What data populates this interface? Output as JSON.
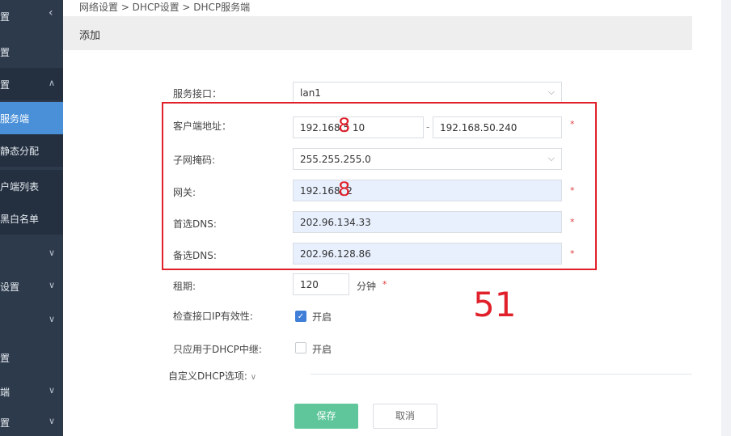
{
  "sidebar": {
    "items": [
      {
        "label": "置",
        "chevron": ""
      },
      {
        "label": "置",
        "chevron": "∧"
      },
      {
        "label": "服务端",
        "chevron": ""
      },
      {
        "label": "静态分配",
        "chevron": ""
      },
      {
        "label": "户端列表",
        "chevron": ""
      },
      {
        "label": "黑白名单",
        "chevron": ""
      },
      {
        "label": "",
        "chevron": "∨"
      },
      {
        "label": "设置",
        "chevron": "∨"
      },
      {
        "label": "",
        "chevron": "∨"
      },
      {
        "label": "置",
        "chevron": ""
      },
      {
        "label": "端",
        "chevron": "∨"
      },
      {
        "label": "置",
        "chevron": "∨"
      }
    ],
    "top_label": "置"
  },
  "breadcrumb": "网络设置 > DHCP设置 > DHCP服务端",
  "page_title": "添加",
  "form": {
    "interface": {
      "label": "服务接口：",
      "value": "lan1"
    },
    "client_address": {
      "label": "客户端地址：",
      "start": "192.168.5  10",
      "end": "192.168.50.240",
      "dash": "-"
    },
    "subnet_mask": {
      "label": "子网掩码:",
      "value": "255.255.255.0"
    },
    "gateway": {
      "label": "网关:",
      "value": "192.168.  2"
    },
    "primary_dns": {
      "label": "首选DNS:",
      "value": "202.96.134.33"
    },
    "secondary_dns": {
      "label": "备选DNS:",
      "value": "202.96.128.86"
    },
    "lease": {
      "label": "租期:",
      "value": "120",
      "unit": "分钟"
    },
    "check_ip": {
      "label": "检查接口IP有效性:",
      "option": "开启",
      "checked": true
    },
    "relay_only": {
      "label": "只应用于DHCP中继:",
      "option": "开启",
      "checked": false
    },
    "custom_options": {
      "label": "自定义DHCP选项:"
    },
    "required_mark": "*"
  },
  "annotations": {
    "digit_a": "8",
    "digit_b": "8",
    "number": "51"
  },
  "buttons": {
    "save": "保存",
    "cancel": "取消"
  },
  "colors": {
    "sidebar": "#2d3a4b",
    "active": "#4a90d9",
    "save": "#5ec69a",
    "annotation": "#e0202a"
  }
}
